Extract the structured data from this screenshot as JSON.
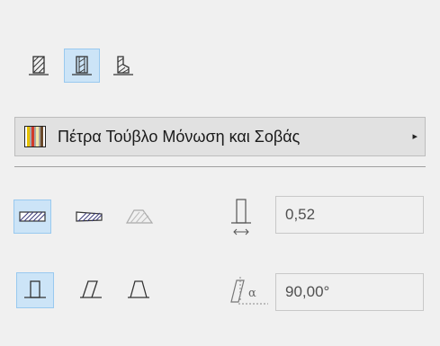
{
  "composite": {
    "name": "Πέτρα Τούβλο Μόνωση και Σοβάς",
    "arrow": "▸"
  },
  "fields": {
    "thickness_value": "0,52",
    "angle_value": "90,00°",
    "angle_symbol": "α"
  },
  "colors": {
    "panel_bg": "#f0f0f0",
    "selected_bg": "#cce4f7",
    "selected_border": "#99c9ef",
    "hatch_fill": "#3a3a7a"
  },
  "icons": {
    "structure_basic": "basic-structure-icon",
    "structure_composite": "composite-structure-icon",
    "structure_profile": "profile-structure-icon",
    "composite_swatch": "composite-swatch-icon",
    "composite_menu": "triangle-right-icon",
    "fill_both": "fill-both-faces-icon",
    "fill_slanted": "fill-slanted-icon",
    "fill_trapezoid": "fill-trapezoid-icon",
    "thickness": "thickness-icon",
    "geom_straight": "straight-wall-icon",
    "geom_slanted": "slanted-wall-icon",
    "geom_trapezoid": "trapezoid-wall-icon",
    "angle": "wall-angle-icon"
  }
}
